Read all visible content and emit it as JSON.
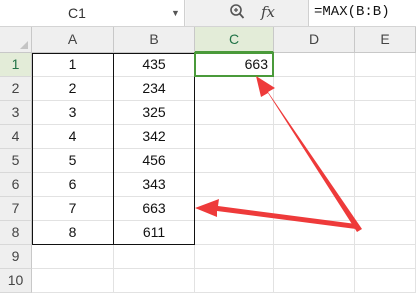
{
  "formula_bar": {
    "name_box": "C1",
    "zoom_icon": "magnifier-zoom-icon",
    "fx_label": "fx",
    "formula": "=MAX(B:B)"
  },
  "columns": [
    "A",
    "B",
    "C",
    "D",
    "E"
  ],
  "active_column": "C",
  "rows": [
    "1",
    "2",
    "3",
    "4",
    "5",
    "6",
    "7",
    "8",
    "9",
    "10"
  ],
  "active_row": "1",
  "table": {
    "col_a": [
      "1",
      "2",
      "3",
      "4",
      "5",
      "6",
      "7",
      "8"
    ],
    "col_b": [
      "435",
      "234",
      "325",
      "342",
      "456",
      "343",
      "663",
      "611"
    ]
  },
  "result": {
    "cell": "C1",
    "value": "663"
  },
  "annotations": {
    "arrow_color": "#ee3a3a",
    "arrows": [
      "arrow pointing to C1 result",
      "arrow pointing to B7 maximum value"
    ]
  },
  "colors": {
    "selection_green": "#4a9a3a",
    "header_bg": "#efefef",
    "grid_line": "#e2e2e2"
  }
}
